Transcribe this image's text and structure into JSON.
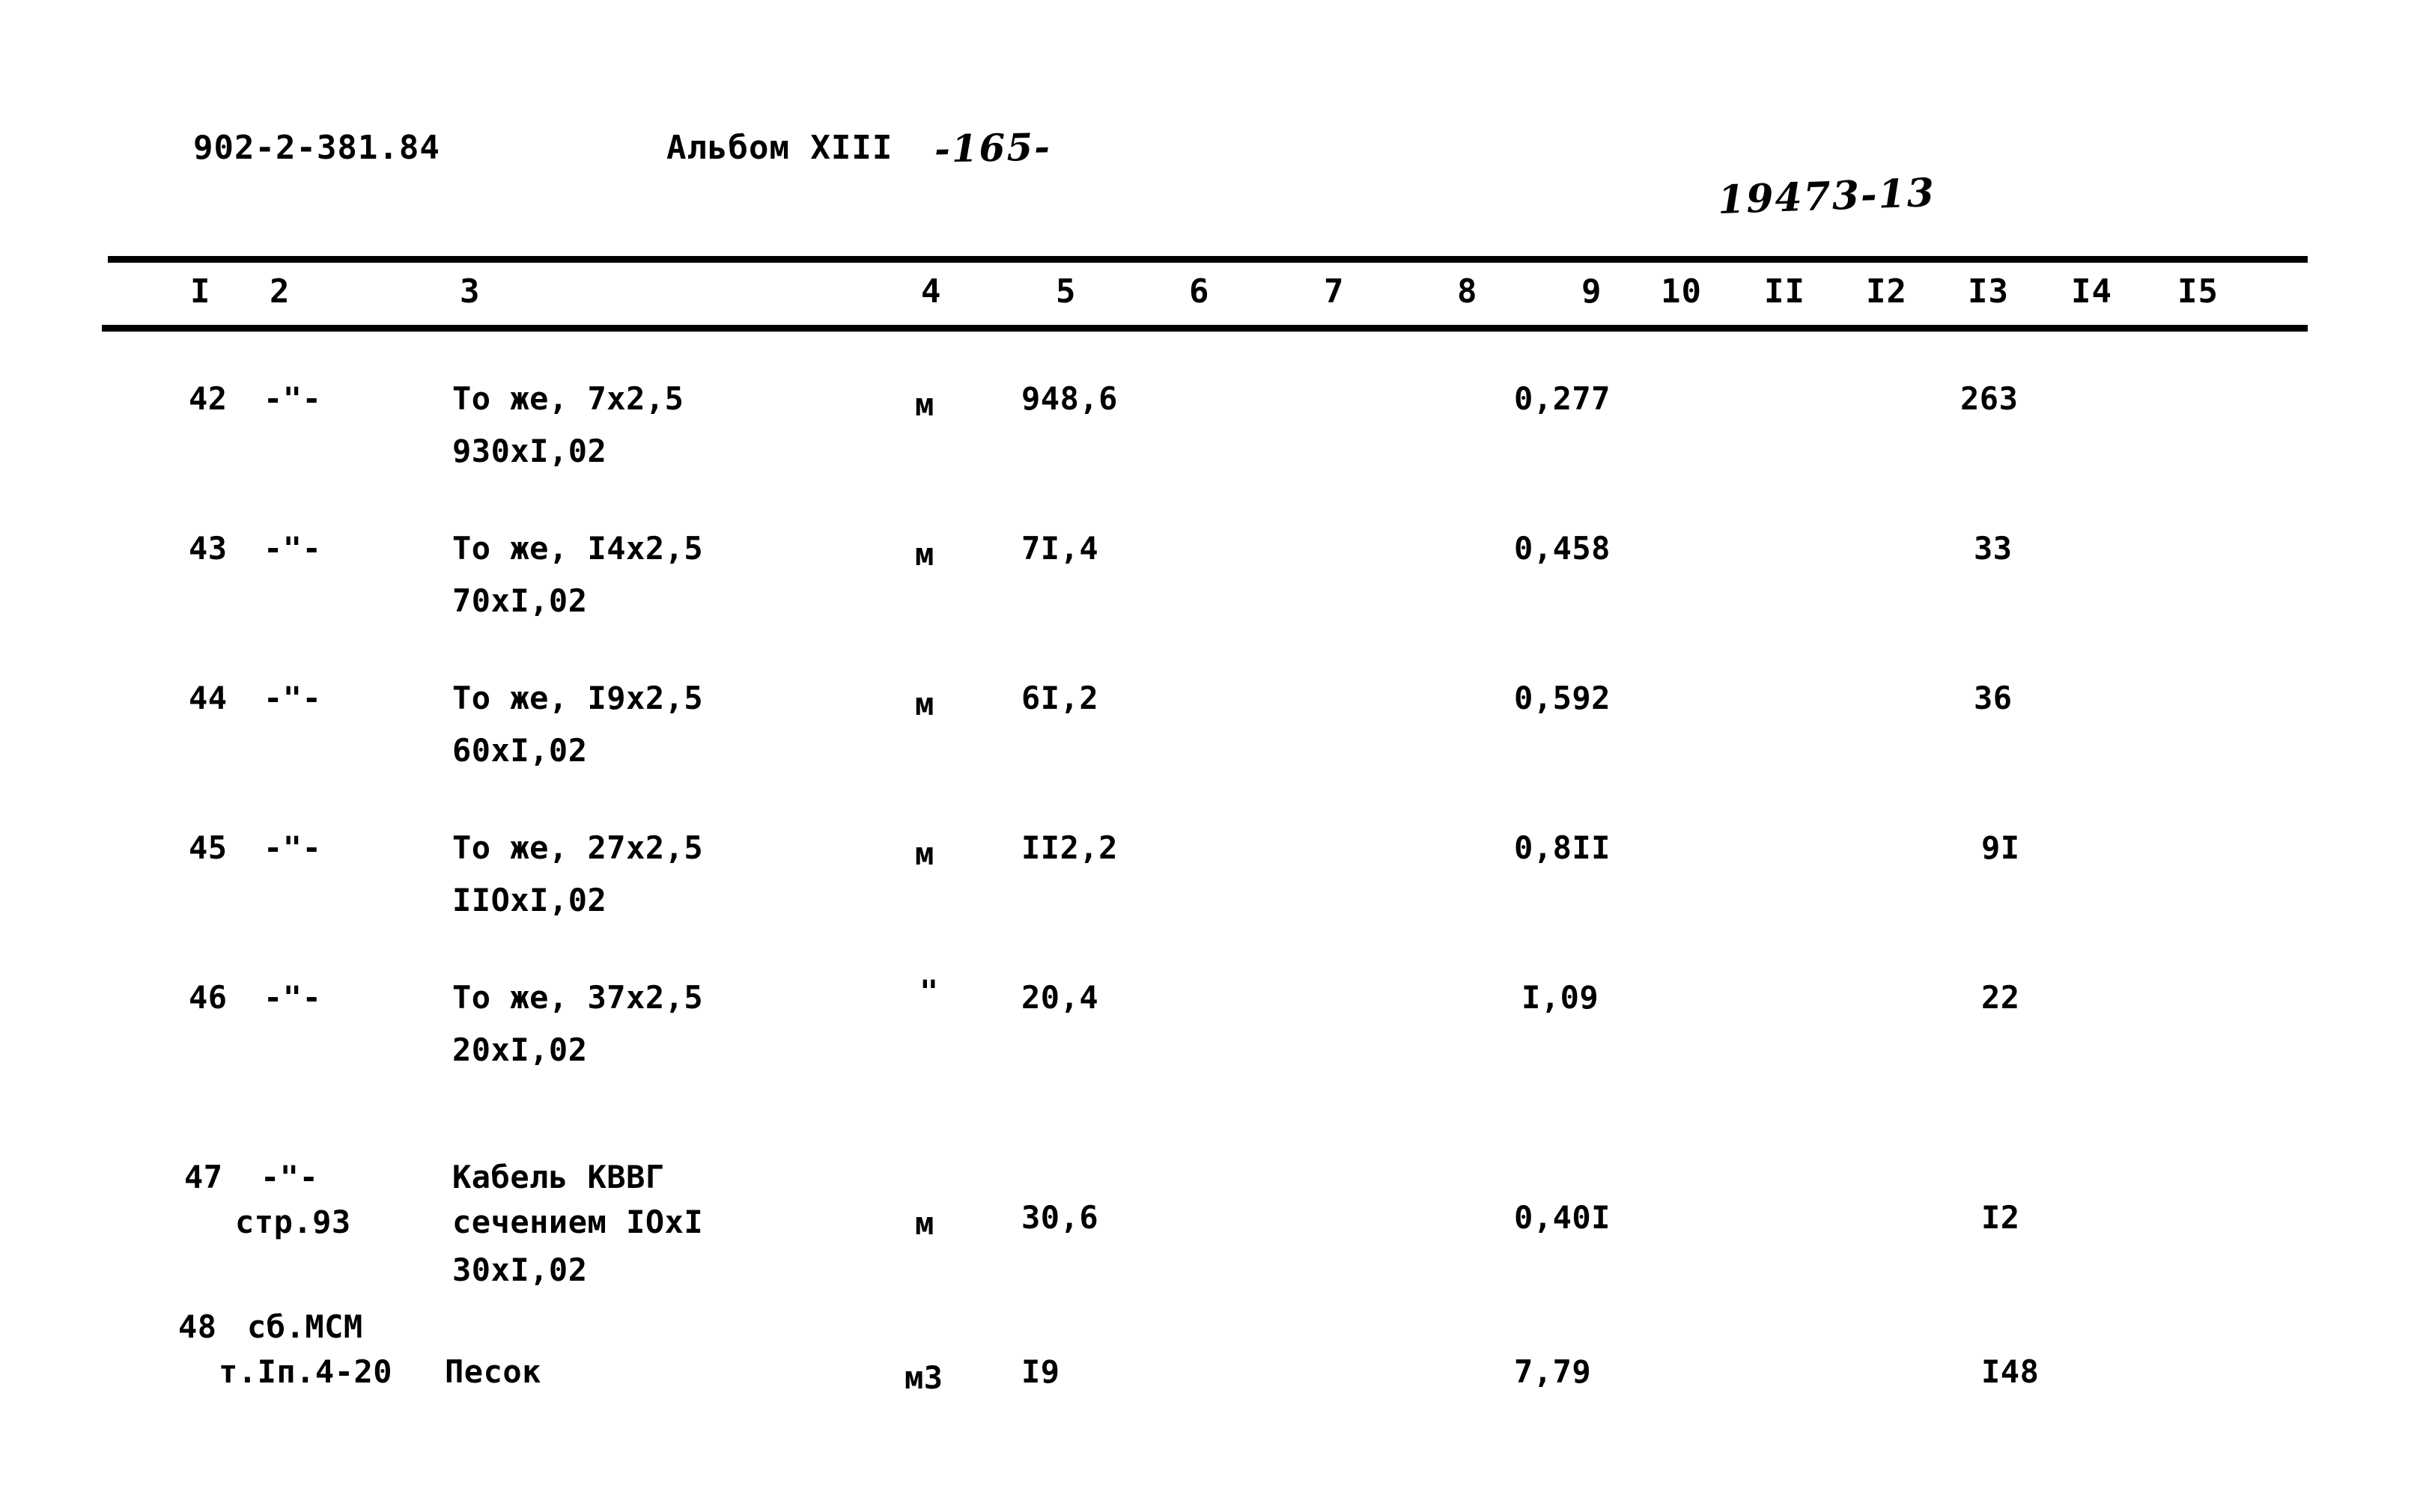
{
  "header": {
    "document_code": "902-2-381.84",
    "album": "Альбом XIII",
    "page_marker": "-165-",
    "stamp": "19473-13"
  },
  "table": {
    "column_headers": [
      "I",
      "2",
      "3",
      "4",
      "5",
      "6",
      "7",
      "8",
      "9",
      "10",
      "II",
      "I2",
      "I3",
      "I4",
      "I5"
    ],
    "rows": [
      {
        "num": "42",
        "ref": "-\"-",
        "ref2": "",
        "desc": "То же, 7х2,5",
        "desc2": "930хI,02",
        "desc3": "",
        "unit": "м",
        "qty": "948,6",
        "c9": "0,277",
        "c13": "263"
      },
      {
        "num": "43",
        "ref": "-\"-",
        "ref2": "",
        "desc": "То же, I4х2,5",
        "desc2": "70хI,02",
        "desc3": "",
        "unit": "м",
        "qty": "7I,4",
        "c9": "0,458",
        "c13": "33"
      },
      {
        "num": "44",
        "ref": "-\"-",
        "ref2": "",
        "desc": "То же, I9х2,5",
        "desc2": "60хI,02",
        "desc3": "",
        "unit": "м",
        "qty": "6I,2",
        "c9": "0,592",
        "c13": "36"
      },
      {
        "num": "45",
        "ref": "-\"-",
        "ref2": "",
        "desc": "То же, 27х2,5",
        "desc2": "IIОхI,02",
        "desc3": "",
        "unit": "м",
        "qty": "II2,2",
        "c9": "0,8II",
        "c13": "9I"
      },
      {
        "num": "46",
        "ref": "-\"-",
        "ref2": "",
        "desc": "То же, 37х2,5",
        "desc2": "20хI,02",
        "desc3": "",
        "unit": "\"",
        "qty": "20,4",
        "c9": "I,09",
        "c13": "22"
      },
      {
        "num": "47",
        "ref": "-\"-",
        "ref2": "стр.93",
        "desc": "Кабель КВВГ",
        "desc2": "сечением IОхI",
        "desc3": "30хI,02",
        "unit": "м",
        "qty": "30,6",
        "c9": "0,40I",
        "c13": "I2"
      },
      {
        "num": "48",
        "ref": "сб.МСМ",
        "ref2": "т.Iп.4-20",
        "desc": "Песок",
        "desc2": "",
        "desc3": "",
        "unit": "м3",
        "qty": "I9",
        "c9": "7,79",
        "c13": "I48"
      }
    ]
  }
}
